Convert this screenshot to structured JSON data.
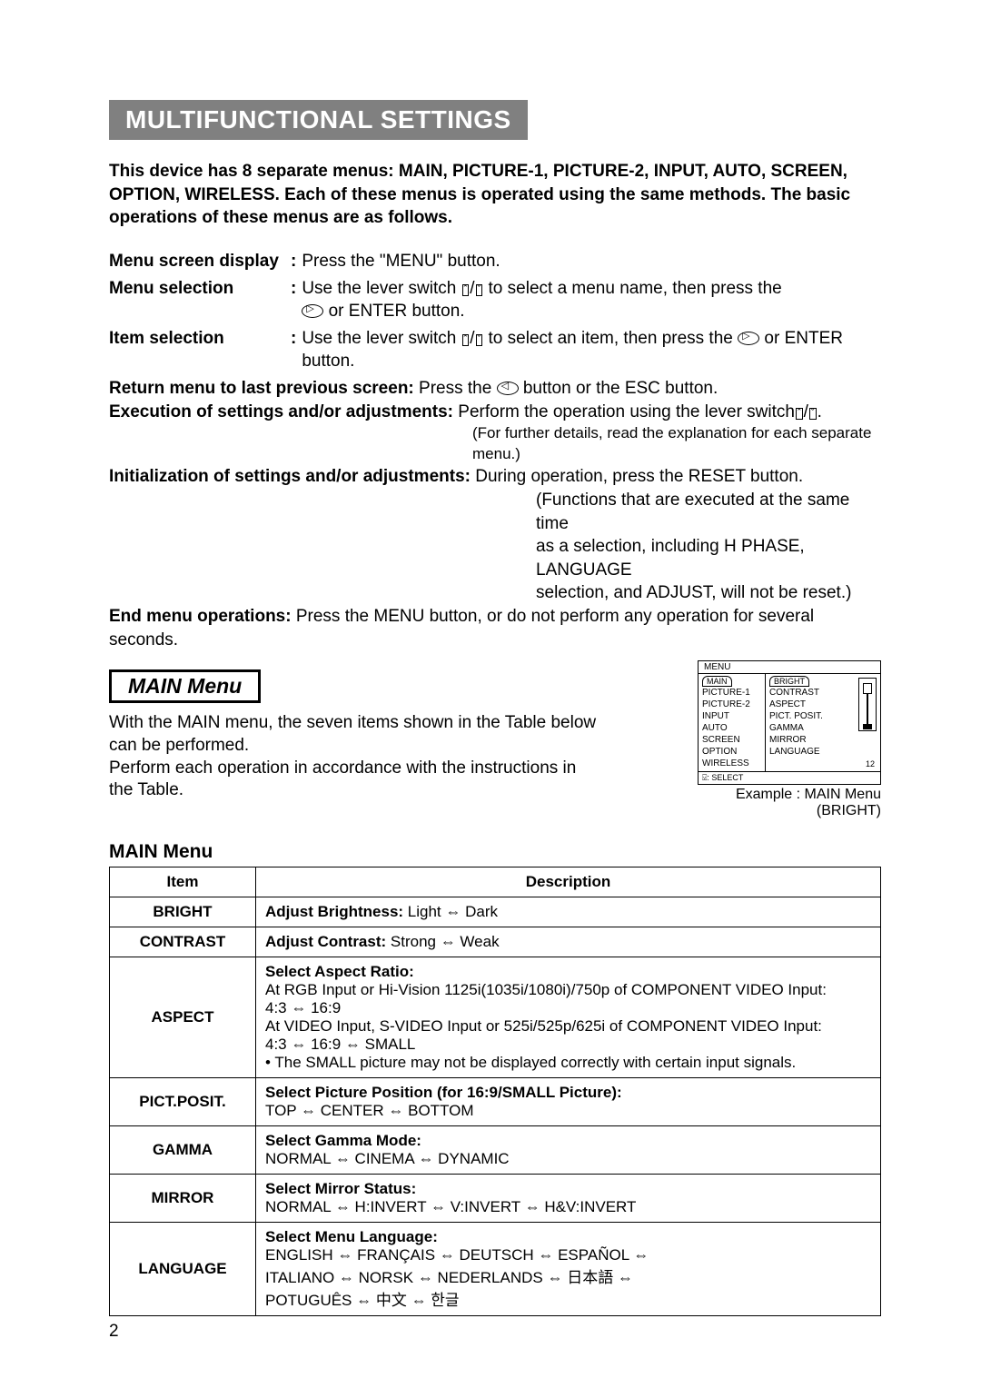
{
  "banner": "MULTIFUNCTIONAL SETTINGS",
  "intro": "This device has 8 separate menus: MAIN, PICTURE-1, PICTURE-2, INPUT, AUTO, SCREEN, OPTION, WIRELESS. Each of these menus is operated using the same methods. The basic operations of these menus are as follows.",
  "ops": {
    "menu_screen": {
      "label": "Menu screen display",
      "colon": ":",
      "val": "Press the \"MENU\" button."
    },
    "menu_sel": {
      "label": "Menu selection",
      "colon": ":",
      "val1": "Use the lever switch ",
      "val2": " to select a menu name, then press the ",
      "val3": " or ENTER button."
    },
    "item_sel": {
      "label": "Item selection",
      "colon": ":",
      "val1": "Use the lever switch ",
      "val2": " to select an item, then press the ",
      "val3": " or ENTER button."
    },
    "return": {
      "label": "Return menu to last previous screen:",
      "val1": " Press the ",
      "val2": " button or the ESC button."
    },
    "exec": {
      "label": "Execution of settings and/or adjustments:",
      "val": " Perform the operation using the lever switch",
      "note": "(For further details, read the explanation for each separate menu.)"
    },
    "init": {
      "label": "Initialization of settings and/or adjustments:",
      "val": " During operation, press the RESET button.",
      "note1": "(Functions that are executed at the same time",
      "note2": "as a selection, including H PHASE, LANGUAGE",
      "note3": "selection, and ADJUST, will not be reset.)"
    },
    "end": {
      "label": "End menu operations:",
      "val": " Press the MENU button, or do not perform any operation for several seconds."
    }
  },
  "section_title": "MAIN Menu",
  "main_desc1": "With the MAIN menu, the seven items shown in the Table below can be performed.",
  "main_desc2": "Perform each operation in accordance with the instructions in the Table.",
  "osd": {
    "title": "MENU",
    "left": [
      "MAIN",
      "PICTURE-1",
      "PICTURE-2",
      "INPUT",
      "AUTO",
      "SCREEN",
      "OPTION",
      "WIRELESS"
    ],
    "right": [
      "BRIGHT",
      "CONTRAST",
      "ASPECT",
      "PICT. POSIT.",
      "GAMMA",
      "MIRROR",
      "LANGUAGE"
    ],
    "val": "12",
    "select": ": SELECT",
    "caption1": "Example : MAIN Menu",
    "caption2": "(BRIGHT)"
  },
  "table": {
    "title": "MAIN Menu",
    "hdr_item": "Item",
    "hdr_desc": "Description",
    "rows": [
      {
        "item": "BRIGHT",
        "title": "Adjust Brightness:",
        "body": "  Light  ⇔  Dark"
      },
      {
        "item": "CONTRAST",
        "title": "Adjust Contrast:",
        "body": "   Strong  ⇔  Weak"
      },
      {
        "item": "ASPECT",
        "title": "Select Aspect Ratio:",
        "body": "At RGB Input or Hi-Vision 1125i(1035i/1080i)/750p of COMPONENT VIDEO Input:\n4:3  ⇔  16:9\nAt VIDEO Input, S-VIDEO Input or 525i/525p/625i of COMPONENT VIDEO Input:\n4:3  ⇔  16:9  ⇔  SMALL\n• The SMALL picture may not be displayed correctly with certain input signals."
      },
      {
        "item": "PICT.POSIT.",
        "title": "Select Picture Position (for 16:9/SMALL Picture):",
        "body": "TOP  ⇔  CENTER  ⇔  BOTTOM"
      },
      {
        "item": "GAMMA",
        "title": "Select Gamma Mode:",
        "body": "NORMAL  ⇔  CINEMA  ⇔  DYNAMIC"
      },
      {
        "item": "MIRROR",
        "title": "Select Mirror Status:",
        "body": "NORMAL  ⇔  H:INVERT  ⇔  V:INVERT  ⇔  H&V:INVERT"
      },
      {
        "item": "LANGUAGE",
        "title": "Select Menu Language:",
        "body": "ENGLISH  ⇔  FRANÇAIS  ⇔  DEUTSCH  ⇔  ESPAÑOL  ⇔ \nITALIANO  ⇔  NORSK  ⇔  NEDERLANDS  ⇔  日本語  ⇔ \nPOTUGUÊS  ⇔  中文  ⇔  한글"
      }
    ]
  },
  "page_num": "2"
}
